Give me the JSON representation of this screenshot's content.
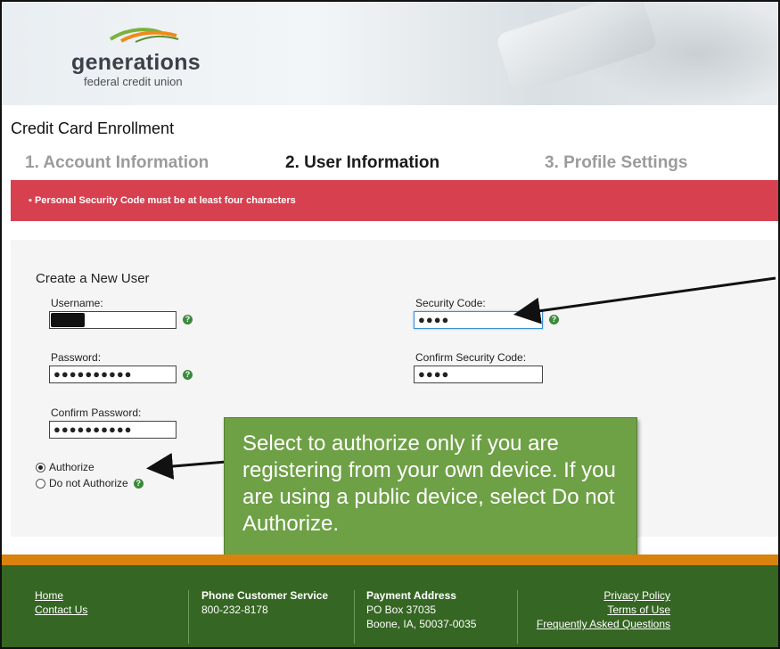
{
  "logo": {
    "name": "generations",
    "subtitle": "federal credit union"
  },
  "page": {
    "title": "Credit Card Enrollment"
  },
  "steps": [
    {
      "label": "1.  Account Information",
      "state": "inactive"
    },
    {
      "label": "2.  User Information",
      "state": "active"
    },
    {
      "label": "3.  Profile Settings",
      "state": "inactive"
    }
  ],
  "alert": {
    "message": "Personal Security Code must be at least four characters",
    "color": "#d7404f"
  },
  "form": {
    "section_title": "Create a New User",
    "username": {
      "label": "Username:",
      "value": ""
    },
    "password": {
      "label": "Password:",
      "value": "●●●●●●●●●●"
    },
    "confirm_password": {
      "label": "Confirm Password:",
      "value": "●●●●●●●●●●"
    },
    "security_code": {
      "label": "Security Code:",
      "value": "●●●●"
    },
    "confirm_security_code": {
      "label": "Confirm Security Code:",
      "value": "●●●●"
    },
    "authorize": {
      "label": "Authorize",
      "checked": true
    },
    "do_not_authorize": {
      "label": "Do not Authorize",
      "checked": false
    },
    "help_icon": "question-circle-icon"
  },
  "callout": {
    "text": "Select to authorize only if you are registering from your own device.  If you are using a public device, select Do not Authorize."
  },
  "footer": {
    "links_left": [
      "Home",
      "Contact Us"
    ],
    "phone": {
      "heading": "Phone Customer Service",
      "number": "800-232-8178"
    },
    "payment": {
      "heading": "Payment Address",
      "line1": "PO Box 37035",
      "line2": "Boone, IA, 50037-0035"
    },
    "links_right": [
      "Privacy Policy",
      "Terms of Use",
      "Frequently Asked Questions"
    ]
  },
  "colors": {
    "accent_green": "#356623",
    "orange": "#d9820e",
    "callout_green": "#6ea046",
    "help_green": "#3b8a3a"
  }
}
